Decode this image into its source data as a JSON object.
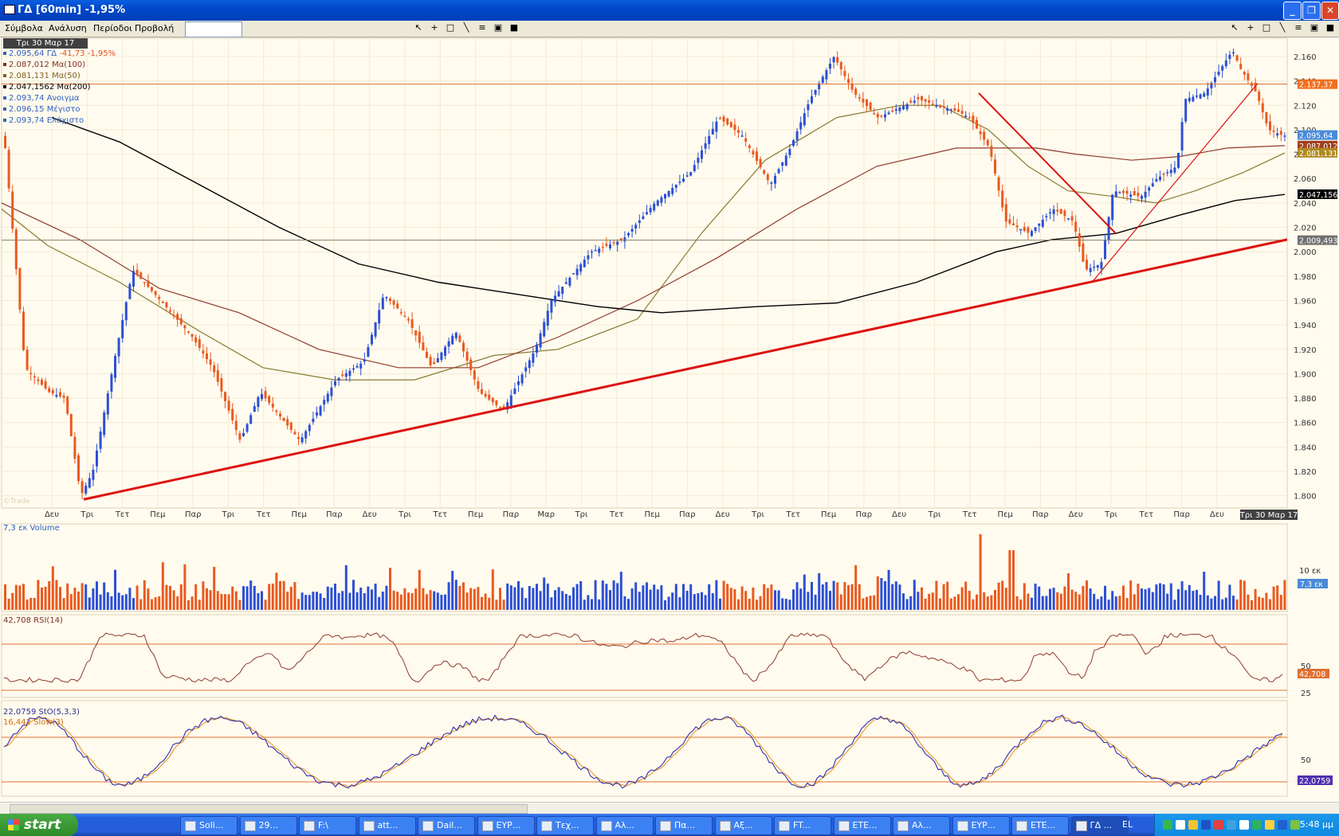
{
  "window": {
    "title": "ΓΔ [60min] -1,95%"
  },
  "menu": [
    "Σύμβολα",
    "Ανάλυση",
    "Περίοδοι",
    "Προβολή"
  ],
  "symbol_input": {
    "value": ""
  },
  "price_panel": {
    "date_label": "Τρι 30 Μαρ 17",
    "legend": [
      {
        "value": "2.095,64",
        "name": "ΓΔ",
        "change": "-41,73 -1,95%",
        "color": "#3060c0"
      },
      {
        "value": "2.087,012",
        "name": "Mα(100)",
        "change": "",
        "color": "#803020"
      },
      {
        "value": "2.081,131",
        "name": "Mα(50)",
        "change": "",
        "color": "#806020"
      },
      {
        "value": "2.047,1562",
        "name": "Mα(200)",
        "change": "",
        "color": "#000000"
      },
      {
        "value": "2.093,74",
        "name": "Ανοιγμα",
        "change": "",
        "color": "#3060c0"
      },
      {
        "value": "2.096,15",
        "name": "Μέγιστο",
        "change": "",
        "color": "#3060c0"
      },
      {
        "value": "2.093,74",
        "name": "Ελάχιστο",
        "change": "",
        "color": "#3060c0"
      }
    ],
    "y_ticks": [
      "2.160",
      "2.140",
      "2.120",
      "2.100",
      "2.080",
      "2.060",
      "2.040",
      "2.020",
      "2.000",
      "1.980",
      "1.960",
      "1.940",
      "1.920",
      "1.900",
      "1.880",
      "1.860",
      "1.840",
      "1.820",
      "1.800"
    ],
    "y_ticks_num": [
      2160,
      2140,
      2120,
      2100,
      2080,
      2060,
      2040,
      2020,
      2000,
      1980,
      1960,
      1940,
      1920,
      1900,
      1880,
      1860,
      1840,
      1820,
      1800
    ],
    "y_range": [
      1790,
      2175
    ],
    "price_tags": [
      {
        "label": "2.137,37",
        "value": 2137.37,
        "bg": "#f07020",
        "fg": "#ffffff"
      },
      {
        "label": "2.095,64",
        "value": 2095.64,
        "bg": "#4a8ad8",
        "fg": "#ffffff"
      },
      {
        "label": "2.087,012",
        "value": 2087.012,
        "bg": "#a04020",
        "fg": "#ffffff"
      },
      {
        "label": "2.081,131",
        "value": 2081.131,
        "bg": "#b08a20",
        "fg": "#ffffff"
      },
      {
        "label": "2.047,156",
        "value": 2047.156,
        "bg": "#000000",
        "fg": "#ffffff"
      },
      {
        "label": "2.009,493",
        "value": 2009.493,
        "bg": "#707070",
        "fg": "#ffffff"
      }
    ],
    "x_labels": [
      "Δευ",
      "Τρι",
      "Τετ",
      "Πεμ",
      "Παρ",
      "Τρι",
      "Τετ",
      "Πεμ",
      "Παρ",
      "Δευ",
      "Τρι",
      "Τετ",
      "Πεμ",
      "Παρ",
      "Μαρ",
      "Τρι",
      "Τετ",
      "Πεμ",
      "Παρ",
      "Δευ",
      "Τρι",
      "Τετ",
      "Πεμ",
      "Παρ",
      "Δευ",
      "Τρι",
      "Τετ",
      "Πεμ",
      "Παρ",
      "Δευ",
      "Τρι",
      "Τετ",
      "Παρ",
      "Δευ"
    ],
    "last_date": "Τρι 30 Μαρ 17",
    "watermark": "©Trade"
  },
  "volume_panel": {
    "legend": "7,3 εκ Volume",
    "tick": "10 εκ",
    "tag": "7,3 εκ"
  },
  "rsi_panel": {
    "legend": "42,708 RSI(14)",
    "ticks": [
      "50",
      "25"
    ],
    "tag": "42,708"
  },
  "stoch_panel": {
    "legend1": "22,0759 StO(5,3,3)",
    "legend2": "16,442 Slow(3)",
    "ticks": [
      "50"
    ],
    "tag": "22,0759"
  },
  "taskbar": {
    "start": "start",
    "tasks": [
      "Soli...",
      "29...",
      "F:\\",
      "att...",
      "Dail...",
      "ΕΥΡ...",
      "Τεχ...",
      "Αλ...",
      "Πα...",
      "Αξ...",
      "FT...",
      "ΕΤΕ...",
      "Αλ...",
      "ΕΥΡ...",
      "ΕΤΕ...",
      "ΓΔ ..."
    ],
    "lang": "EL",
    "clock": "5:48 μμ"
  }
}
